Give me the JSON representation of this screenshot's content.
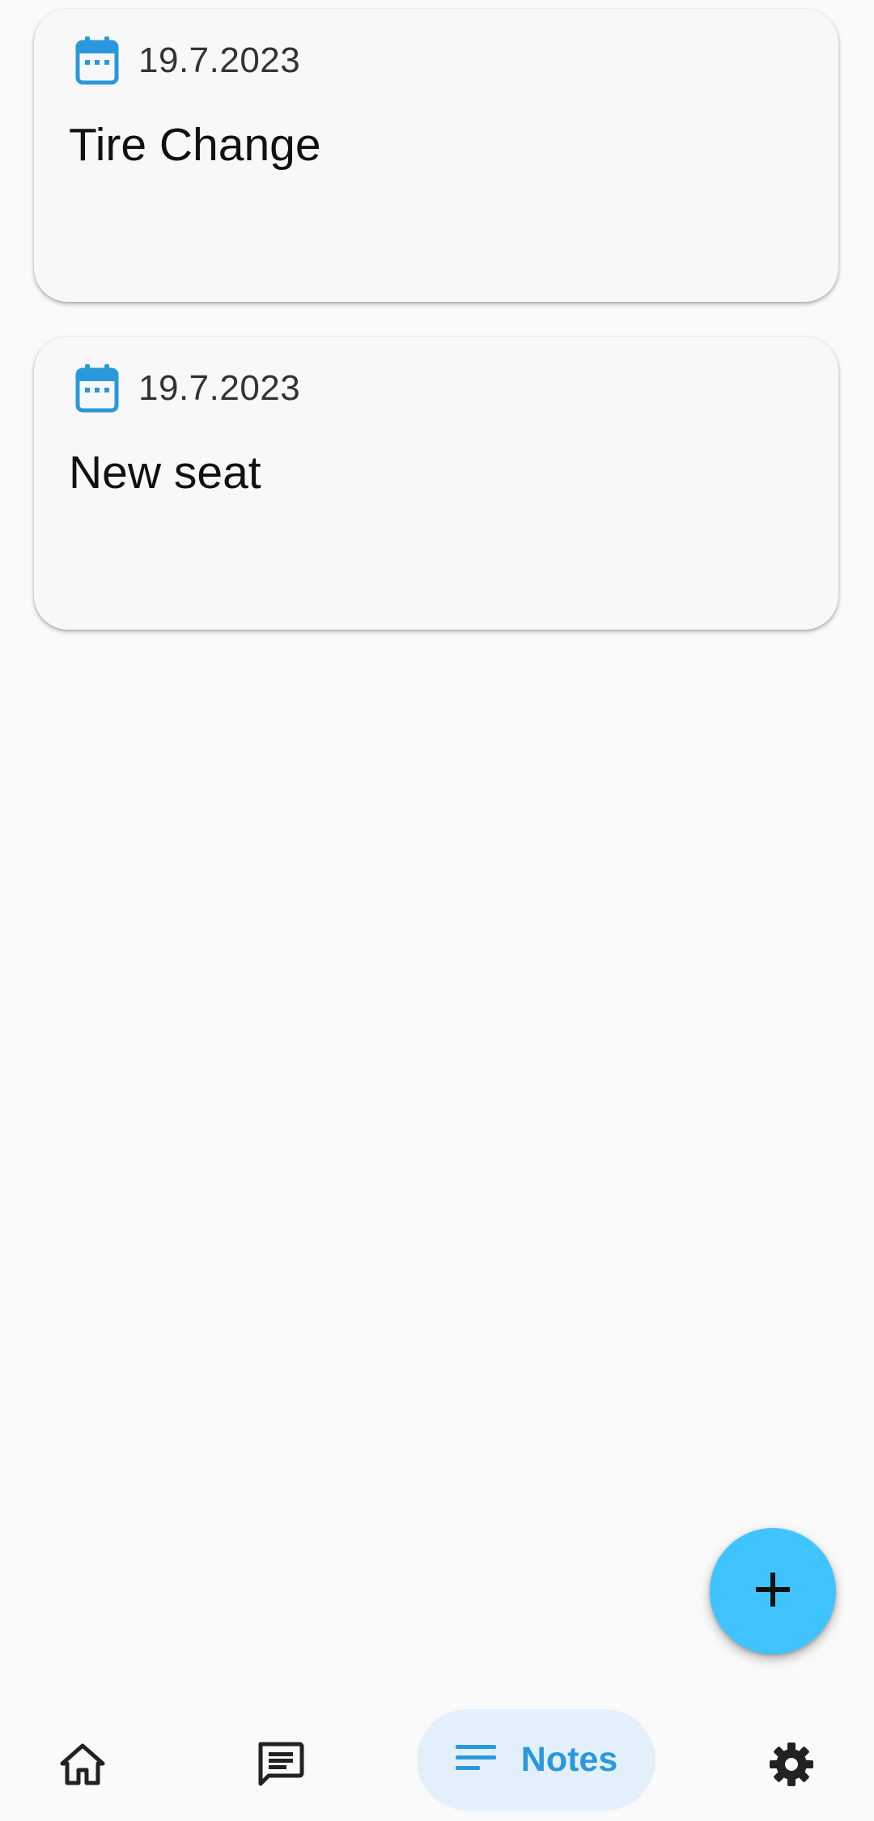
{
  "notes": [
    {
      "date": "19.7.2023",
      "title": "Tire Change"
    },
    {
      "date": "19.7.2023",
      "title": "New seat"
    }
  ],
  "fab": {
    "icon": "plus-icon"
  },
  "bottom_nav": {
    "items": [
      {
        "icon": "home-icon",
        "label": ""
      },
      {
        "icon": "chat-icon",
        "label": ""
      },
      {
        "icon": "notes-icon",
        "label": "Notes",
        "selected": true
      },
      {
        "icon": "gear-icon",
        "label": ""
      }
    ]
  },
  "colors": {
    "accent": "#2a98dc",
    "fab": "#40c4ff",
    "selected_pill": "#e3f0fb",
    "background": "#fafafa"
  }
}
